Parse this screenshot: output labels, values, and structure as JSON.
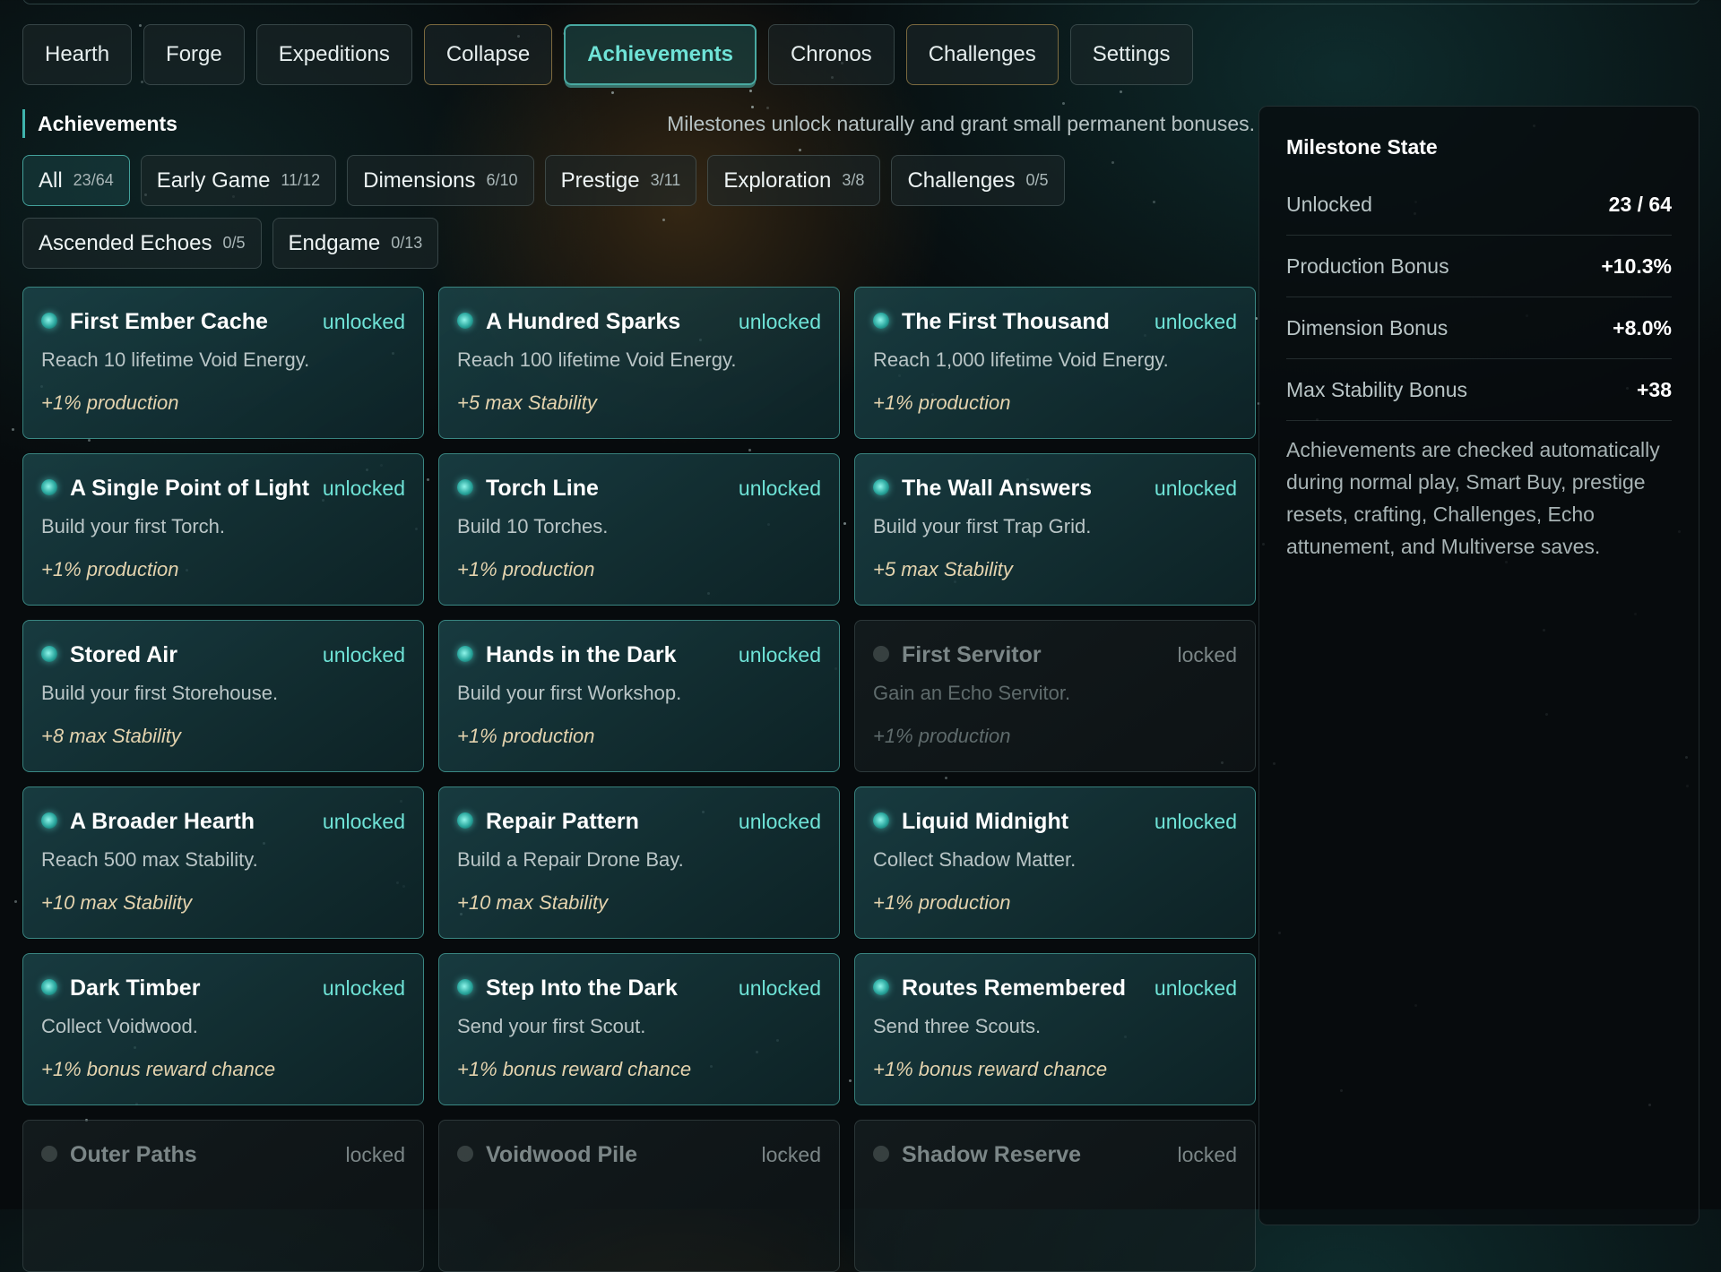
{
  "tabs": [
    {
      "label": "Hearth",
      "active": false
    },
    {
      "label": "Forge",
      "active": false
    },
    {
      "label": "Expeditions",
      "active": false
    },
    {
      "label": "Collapse",
      "active": false
    },
    {
      "label": "Achievements",
      "active": true
    },
    {
      "label": "Chronos",
      "active": false
    },
    {
      "label": "Challenges",
      "active": false
    },
    {
      "label": "Settings",
      "active": false
    }
  ],
  "section": {
    "title": "Achievements",
    "description": "Milestones unlock naturally and grant small permanent bonuses."
  },
  "filters": [
    {
      "label": "All",
      "count": "23/64",
      "active": true
    },
    {
      "label": "Early Game",
      "count": "11/12"
    },
    {
      "label": "Dimensions",
      "count": "6/10"
    },
    {
      "label": "Prestige",
      "count": "3/11"
    },
    {
      "label": "Exploration",
      "count": "3/8"
    },
    {
      "label": "Challenges",
      "count": "0/5"
    },
    {
      "label": "Ascended Echoes",
      "count": "0/5"
    },
    {
      "label": "Endgame",
      "count": "0/13"
    }
  ],
  "achievements": [
    {
      "title": "First Ember Cache",
      "status": "unlocked",
      "description": "Reach 10 lifetime Void Energy.",
      "reward": "+1% production"
    },
    {
      "title": "A Hundred Sparks",
      "status": "unlocked",
      "description": "Reach 100 lifetime Void Energy.",
      "reward": "+5 max Stability"
    },
    {
      "title": "The First Thousand",
      "status": "unlocked",
      "description": "Reach 1,000 lifetime Void Energy.",
      "reward": "+1% production"
    },
    {
      "title": "A Single Point of Light",
      "status": "unlocked",
      "description": "Build your first Torch.",
      "reward": "+1% production"
    },
    {
      "title": "Torch Line",
      "status": "unlocked",
      "description": "Build 10 Torches.",
      "reward": "+1% production"
    },
    {
      "title": "The Wall Answers",
      "status": "unlocked",
      "description": "Build your first Trap Grid.",
      "reward": "+5 max Stability"
    },
    {
      "title": "Stored Air",
      "status": "unlocked",
      "description": "Build your first Storehouse.",
      "reward": "+8 max Stability"
    },
    {
      "title": "Hands in the Dark",
      "status": "unlocked",
      "description": "Build your first Workshop.",
      "reward": "+1% production"
    },
    {
      "title": "First Servitor",
      "status": "locked",
      "description": "Gain an Echo Servitor.",
      "reward": "+1% production"
    },
    {
      "title": "A Broader Hearth",
      "status": "unlocked",
      "description": "Reach 500 max Stability.",
      "reward": "+10 max Stability"
    },
    {
      "title": "Repair Pattern",
      "status": "unlocked",
      "description": "Build a Repair Drone Bay.",
      "reward": "+10 max Stability"
    },
    {
      "title": "Liquid Midnight",
      "status": "unlocked",
      "description": "Collect Shadow Matter.",
      "reward": "+1% production"
    },
    {
      "title": "Dark Timber",
      "status": "unlocked",
      "description": "Collect Voidwood.",
      "reward": "+1% bonus reward chance"
    },
    {
      "title": "Step Into the Dark",
      "status": "unlocked",
      "description": "Send your first Scout.",
      "reward": "+1% bonus reward chance"
    },
    {
      "title": "Routes Remembered",
      "status": "unlocked",
      "description": "Send three Scouts.",
      "reward": "+1% bonus reward chance"
    },
    {
      "title": "Outer Paths",
      "status": "locked",
      "description": "",
      "reward": ""
    },
    {
      "title": "Voidwood Pile",
      "status": "locked",
      "description": "",
      "reward": ""
    },
    {
      "title": "Shadow Reserve",
      "status": "locked",
      "description": "",
      "reward": ""
    }
  ],
  "panel": {
    "title": "Milestone State",
    "stats": [
      {
        "label": "Unlocked",
        "value": "23 / 64"
      },
      {
        "label": "Production Bonus",
        "value": "+10.3%"
      },
      {
        "label": "Dimension Bonus",
        "value": "+8.0%"
      },
      {
        "label": "Max Stability Bonus",
        "value": "+38"
      }
    ],
    "note": "Achievements are checked automatically during normal play, Smart Buy, prestige resets, crafting, Challenges, Echo attunement, and Multiverse saves."
  },
  "colors": {
    "accent": "#6fe3d7",
    "reward": "#e4d3ae",
    "background": "#070b0d"
  }
}
